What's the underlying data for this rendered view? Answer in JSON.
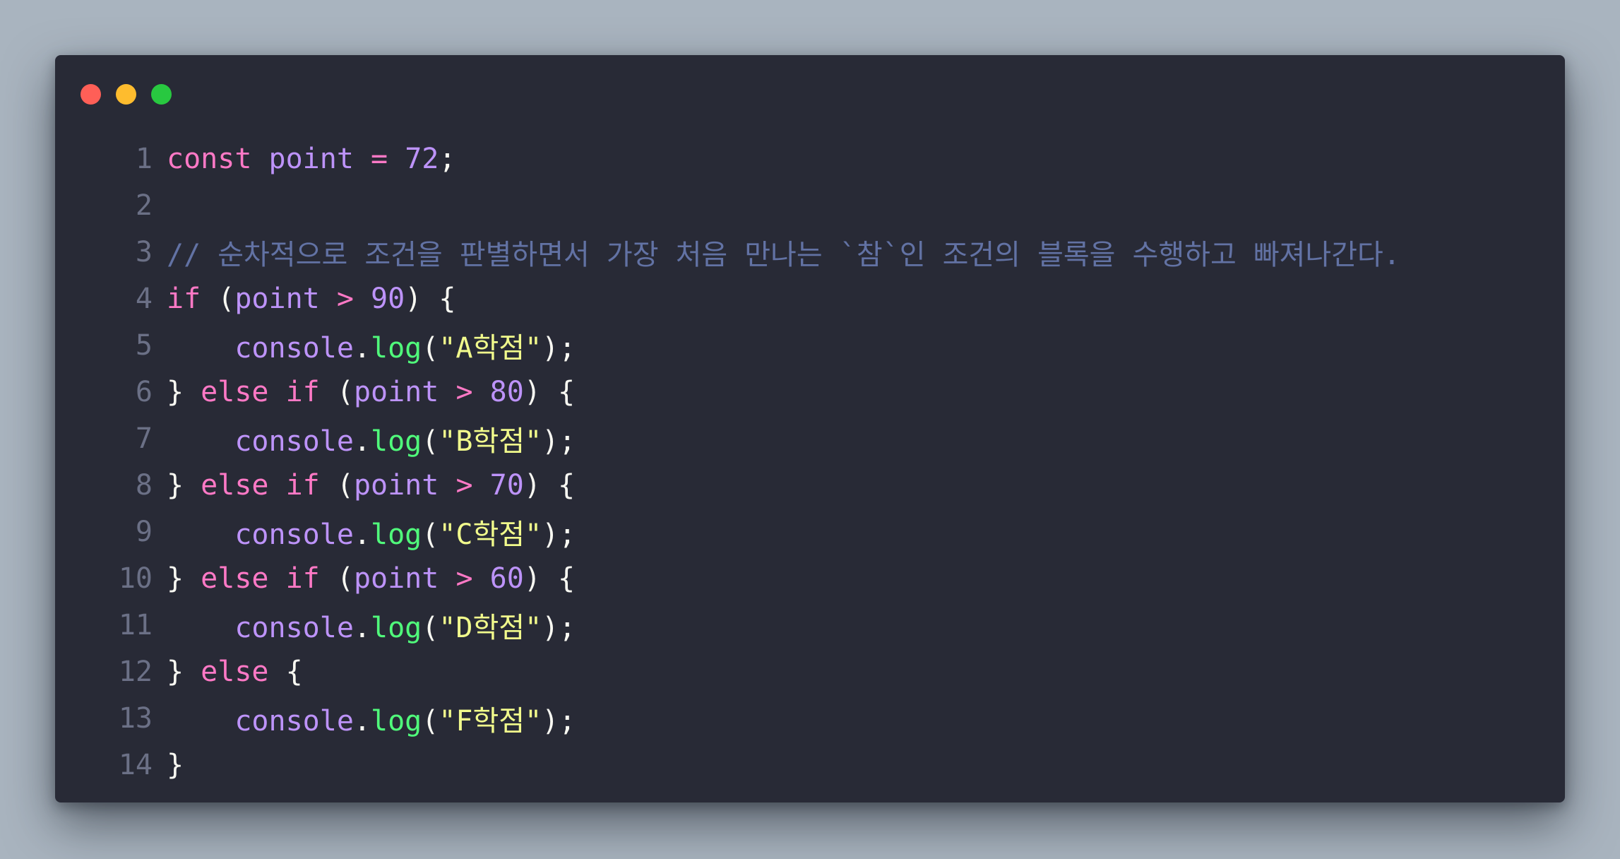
{
  "window": {
    "controls": [
      {
        "name": "close",
        "color": "#ff5f57"
      },
      {
        "name": "minimize",
        "color": "#febc2e"
      },
      {
        "name": "maximize",
        "color": "#28c840"
      }
    ]
  },
  "colors": {
    "background": "#a9b4bf",
    "editor_bg": "#282a36",
    "keyword": "#ff79c6",
    "variable": "#bd93f9",
    "function": "#50fa7b",
    "string": "#f1fa8c",
    "comment": "#6272a4"
  },
  "code": {
    "lines": [
      {
        "n": "1",
        "indent": "",
        "tokens": [
          {
            "t": "const",
            "c": "kw"
          },
          {
            "t": " ",
            "c": "punc"
          },
          {
            "t": "point",
            "c": "var"
          },
          {
            "t": " ",
            "c": "punc"
          },
          {
            "t": "=",
            "c": "op"
          },
          {
            "t": " ",
            "c": "punc"
          },
          {
            "t": "72",
            "c": "num"
          },
          {
            "t": ";",
            "c": "punc"
          }
        ]
      },
      {
        "n": "2",
        "indent": "",
        "tokens": []
      },
      {
        "n": "3",
        "indent": "",
        "tokens": [
          {
            "t": "// 순차적으로 조건을 판별하면서 가장 처음 만나는 `참`인 조건의 블록을 수행하고 빠져나간다.",
            "c": "cmt"
          }
        ]
      },
      {
        "n": "4",
        "indent": "",
        "tokens": [
          {
            "t": "if",
            "c": "kw"
          },
          {
            "t": " (",
            "c": "punc"
          },
          {
            "t": "point",
            "c": "var"
          },
          {
            "t": " ",
            "c": "punc"
          },
          {
            "t": ">",
            "c": "op"
          },
          {
            "t": " ",
            "c": "punc"
          },
          {
            "t": "90",
            "c": "num"
          },
          {
            "t": ") {",
            "c": "punc"
          }
        ]
      },
      {
        "n": "5",
        "indent": "    ",
        "tokens": [
          {
            "t": "console",
            "c": "obj"
          },
          {
            "t": ".",
            "c": "punc"
          },
          {
            "t": "log",
            "c": "fn"
          },
          {
            "t": "(",
            "c": "punc"
          },
          {
            "t": "\"A학점\"",
            "c": "str"
          },
          {
            "t": ");",
            "c": "punc"
          }
        ]
      },
      {
        "n": "6",
        "indent": "",
        "tokens": [
          {
            "t": "} ",
            "c": "punc"
          },
          {
            "t": "else",
            "c": "kw"
          },
          {
            "t": " ",
            "c": "punc"
          },
          {
            "t": "if",
            "c": "kw"
          },
          {
            "t": " (",
            "c": "punc"
          },
          {
            "t": "point",
            "c": "var"
          },
          {
            "t": " ",
            "c": "punc"
          },
          {
            "t": ">",
            "c": "op"
          },
          {
            "t": " ",
            "c": "punc"
          },
          {
            "t": "80",
            "c": "num"
          },
          {
            "t": ") {",
            "c": "punc"
          }
        ]
      },
      {
        "n": "7",
        "indent": "    ",
        "tokens": [
          {
            "t": "console",
            "c": "obj"
          },
          {
            "t": ".",
            "c": "punc"
          },
          {
            "t": "log",
            "c": "fn"
          },
          {
            "t": "(",
            "c": "punc"
          },
          {
            "t": "\"B학점\"",
            "c": "str"
          },
          {
            "t": ");",
            "c": "punc"
          }
        ]
      },
      {
        "n": "8",
        "indent": "",
        "tokens": [
          {
            "t": "} ",
            "c": "punc"
          },
          {
            "t": "else",
            "c": "kw"
          },
          {
            "t": " ",
            "c": "punc"
          },
          {
            "t": "if",
            "c": "kw"
          },
          {
            "t": " (",
            "c": "punc"
          },
          {
            "t": "point",
            "c": "var"
          },
          {
            "t": " ",
            "c": "punc"
          },
          {
            "t": ">",
            "c": "op"
          },
          {
            "t": " ",
            "c": "punc"
          },
          {
            "t": "70",
            "c": "num"
          },
          {
            "t": ") {",
            "c": "punc"
          }
        ]
      },
      {
        "n": "9",
        "indent": "    ",
        "tokens": [
          {
            "t": "console",
            "c": "obj"
          },
          {
            "t": ".",
            "c": "punc"
          },
          {
            "t": "log",
            "c": "fn"
          },
          {
            "t": "(",
            "c": "punc"
          },
          {
            "t": "\"C학점\"",
            "c": "str"
          },
          {
            "t": ");",
            "c": "punc"
          }
        ]
      },
      {
        "n": "10",
        "indent": "",
        "tokens": [
          {
            "t": "} ",
            "c": "punc"
          },
          {
            "t": "else",
            "c": "kw"
          },
          {
            "t": " ",
            "c": "punc"
          },
          {
            "t": "if",
            "c": "kw"
          },
          {
            "t": " (",
            "c": "punc"
          },
          {
            "t": "point",
            "c": "var"
          },
          {
            "t": " ",
            "c": "punc"
          },
          {
            "t": ">",
            "c": "op"
          },
          {
            "t": " ",
            "c": "punc"
          },
          {
            "t": "60",
            "c": "num"
          },
          {
            "t": ") {",
            "c": "punc"
          }
        ]
      },
      {
        "n": "11",
        "indent": "    ",
        "tokens": [
          {
            "t": "console",
            "c": "obj"
          },
          {
            "t": ".",
            "c": "punc"
          },
          {
            "t": "log",
            "c": "fn"
          },
          {
            "t": "(",
            "c": "punc"
          },
          {
            "t": "\"D학점\"",
            "c": "str"
          },
          {
            "t": ");",
            "c": "punc"
          }
        ]
      },
      {
        "n": "12",
        "indent": "",
        "tokens": [
          {
            "t": "} ",
            "c": "punc"
          },
          {
            "t": "else",
            "c": "kw"
          },
          {
            "t": " {",
            "c": "punc"
          }
        ]
      },
      {
        "n": "13",
        "indent": "    ",
        "tokens": [
          {
            "t": "console",
            "c": "obj"
          },
          {
            "t": ".",
            "c": "punc"
          },
          {
            "t": "log",
            "c": "fn"
          },
          {
            "t": "(",
            "c": "punc"
          },
          {
            "t": "\"F학점\"",
            "c": "str"
          },
          {
            "t": ");",
            "c": "punc"
          }
        ]
      },
      {
        "n": "14",
        "indent": "",
        "tokens": [
          {
            "t": "}",
            "c": "punc"
          }
        ]
      }
    ]
  }
}
